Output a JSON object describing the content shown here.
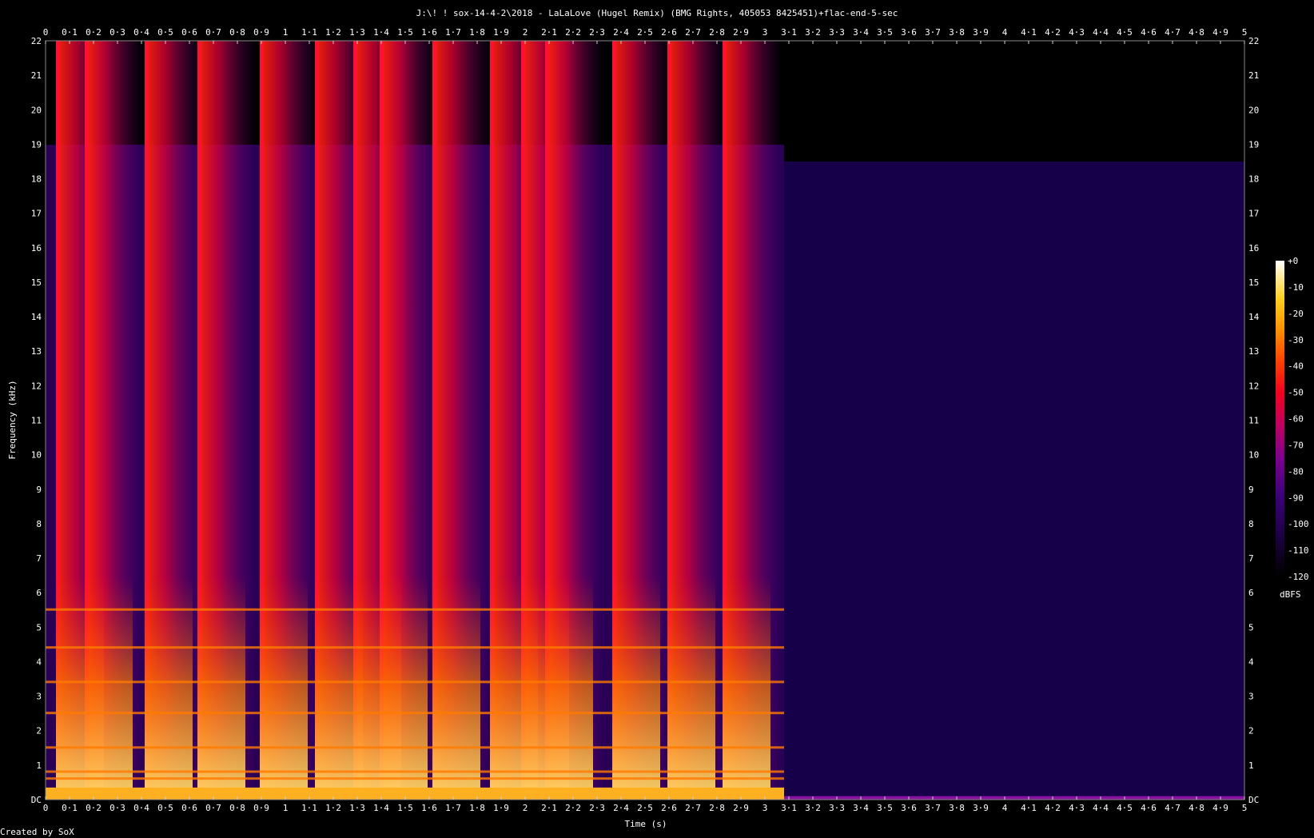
{
  "chart_data": {
    "type": "heatmap",
    "title": "J:\\! ! sox-14-4-2\\2018 - LaLaLove (Hugel Remix) (BMG Rights, 405053 8425451)+flac-end-5-sec",
    "xlabel": "Time (s)",
    "ylabel": "Frequency (kHz)",
    "xlim": [
      0,
      5
    ],
    "ylim": [
      0,
      22
    ],
    "x_ticks": [
      "0",
      "0·1",
      "0·2",
      "0·3",
      "0·4",
      "0·5",
      "0·6",
      "0·7",
      "0·8",
      "0·9",
      "1",
      "1·1",
      "1·2",
      "1·3",
      "1·4",
      "1·5",
      "1·6",
      "1·7",
      "1·8",
      "1·9",
      "2",
      "2·1",
      "2·2",
      "2·3",
      "2·4",
      "2·5",
      "2·6",
      "2·7",
      "2·8",
      "2·9",
      "3",
      "3·1",
      "3·2",
      "3·3",
      "3·4",
      "3·5",
      "3·6",
      "3·7",
      "3·8",
      "3·9",
      "4",
      "4·1",
      "4·2",
      "4·3",
      "4·4",
      "4·5",
      "4·6",
      "4·7",
      "4·8",
      "4·9",
      "5"
    ],
    "y_ticks": [
      "DC",
      "1",
      "2",
      "3",
      "4",
      "5",
      "6",
      "7",
      "8",
      "9",
      "10",
      "11",
      "12",
      "13",
      "14",
      "15",
      "16",
      "17",
      "18",
      "19",
      "20",
      "21",
      "22"
    ],
    "colorbar": {
      "label": "dBFS",
      "ticks": [
        "+0",
        "-10",
        "-20",
        "-30",
        "-40",
        "-50",
        "-60",
        "-70",
        "-80",
        "-90",
        "-100",
        "-110",
        "-120"
      ],
      "range": [
        -120,
        0
      ],
      "colors": [
        "#000000",
        "#1a0040",
        "#3a007a",
        "#7a0090",
        "#c00060",
        "#f00020",
        "#ff4000",
        "#ff9000",
        "#ffd020",
        "#ffffff"
      ]
    },
    "signal_end_s": 3.08,
    "onsets_s": [
      0.05,
      0.17,
      0.42,
      0.64,
      0.9,
      1.13,
      1.29,
      1.4,
      1.62,
      1.86,
      1.99,
      2.09,
      2.37,
      2.6,
      2.83
    ],
    "harmonic_lines_khz": [
      0.6,
      0.8,
      1.5,
      2.5,
      3.4,
      4.4,
      5.5
    ],
    "grid": false,
    "footer": "Created by SoX"
  }
}
